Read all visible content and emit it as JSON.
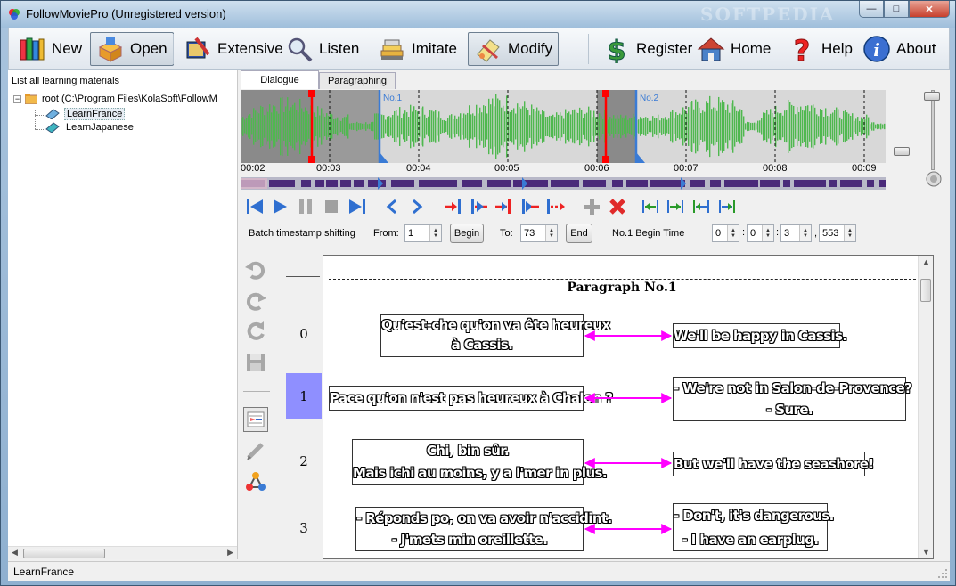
{
  "window": {
    "title": "FollowMoviePro (Unregistered version)",
    "watermark": "SOFTPEDIA",
    "minimize": "—",
    "maximize": "□",
    "close": "✕"
  },
  "toolbar": {
    "new": "New",
    "open": "Open",
    "extensive": "Extensive",
    "listen": "Listen",
    "imitate": "Imitate",
    "modify": "Modify",
    "register": "Register",
    "home": "Home",
    "help": "Help",
    "about": "About"
  },
  "materials": {
    "header": "List all learning materials",
    "root": "root (C:\\Program Files\\KolaSoft\\FollowM",
    "items": [
      "LearnFrance",
      "LearnJapanese"
    ]
  },
  "tabs": {
    "dialogue": "Dialogue",
    "paragraphing": "Paragraphing"
  },
  "waveform": {
    "markers": [
      "No.1",
      "No.2"
    ],
    "timeline": [
      "00:02",
      "00:03",
      "00:04",
      "00:05",
      "00:06",
      "00:07",
      "00:08",
      "00:09"
    ]
  },
  "batch": {
    "label": "Batch timestamp shifting",
    "from_label": "From:",
    "from_value": "1",
    "begin_button": "Begin",
    "to_label": "To:",
    "to_value": "73",
    "end_button": "End",
    "time_label": "No.1 Begin Time",
    "time_h": "0",
    "time_m": "0",
    "time_s": "3",
    "time_ms": "553",
    "sep_colon": ":",
    "sep_comma": ","
  },
  "paragraph": {
    "title": "Paragraph No.1",
    "rows": [
      {
        "num": "0",
        "src1": "Qu'est-che qu'on va ête heureux",
        "src2": "à Cassis.",
        "dst1": "We'll be happy in Cassis.",
        "dst2": ""
      },
      {
        "num": "1",
        "src1": "Pace qu'on n'est pas heureux à Chalon ?",
        "src2": "",
        "dst1": "- We're not in Salon-de-Provence?",
        "dst2": "- Sure."
      },
      {
        "num": "2",
        "src1": "Chi, bin sûr.",
        "src2": "Mais ichi au moins, y a l'mer in plus.",
        "dst1": "But we'll have the seashore!",
        "dst2": ""
      },
      {
        "num": "3",
        "src1": "- Réponds po, on va avoir n'accidint.",
        "src2": "- J'mets min oreillette.",
        "dst1": "- Don't, it's dangerous.",
        "dst2": "- I have an earplug."
      }
    ]
  },
  "status": {
    "text": "LearnFrance"
  },
  "colors": {
    "wave": "#4fb84f",
    "link_arrow": "#ff00ff",
    "selected_row": "#8f8fff",
    "cursor": "#ff0000",
    "segment": "#3a7bd5"
  }
}
